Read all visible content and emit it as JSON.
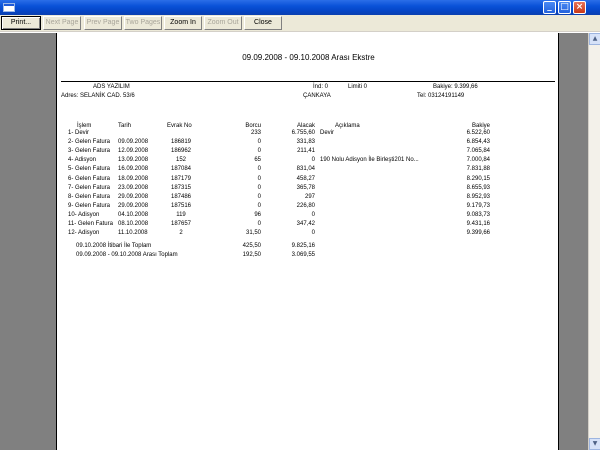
{
  "toolbar": {
    "print": "Print...",
    "next_page": "Next Page",
    "prev_page": "Prev Page",
    "two_pages": "Two Pages",
    "zoom_in": "Zoom In",
    "zoom_out": "Zoom Out",
    "close": "Close"
  },
  "report": {
    "title": "09.09.2008 - 09.10.2008 Arası Ekstre",
    "company": "ADS YAZILIM",
    "address": "Adres: SELANİK CAD. 53/6",
    "discount": "İnd: 0",
    "limit": "Limiti 0",
    "balance": "Bakiye: 9.399,66",
    "district": "ÇANKAYA",
    "phone": "Tel: 03124191149",
    "columns": {
      "islem": "İşlem",
      "tarih": "Tarih",
      "evrak": "Evrak No",
      "borcu": "Borcu",
      "alacak": "Alacak",
      "aciklama": "Açıklama",
      "bakiye": "Bakiye"
    },
    "rows": [
      {
        "islem": "1- Devir",
        "tarih": "",
        "evrak": "",
        "borcu": "233",
        "alacak": "6.755,60",
        "aciklama": "Devir",
        "bakiye": "6.522,60"
      },
      {
        "islem": "2- Gelen Fatura",
        "tarih": "09.09.2008",
        "evrak": "186819",
        "borcu": "0",
        "alacak": "331,83",
        "aciklama": "",
        "bakiye": "6.854,43"
      },
      {
        "islem": "3- Gelen Fatura",
        "tarih": "12.09.2008",
        "evrak": "186962",
        "borcu": "0",
        "alacak": "211,41",
        "aciklama": "",
        "bakiye": "7.065,84"
      },
      {
        "islem": "4- Adisyon",
        "tarih": "13.09.2008",
        "evrak": "152",
        "borcu": "65",
        "alacak": "0",
        "aciklama": "190 Nolu Adisyon İle Birleşti201 No...",
        "bakiye": "7.000,84"
      },
      {
        "islem": "5- Gelen Fatura",
        "tarih": "16.09.2008",
        "evrak": "187084",
        "borcu": "0",
        "alacak": "831,04",
        "aciklama": "",
        "bakiye": "7.831,88"
      },
      {
        "islem": "6- Gelen Fatura",
        "tarih": "18.09.2008",
        "evrak": "187179",
        "borcu": "0",
        "alacak": "458,27",
        "aciklama": "",
        "bakiye": "8.290,15"
      },
      {
        "islem": "7- Gelen Fatura",
        "tarih": "23.09.2008",
        "evrak": "187315",
        "borcu": "0",
        "alacak": "365,78",
        "aciklama": "",
        "bakiye": "8.655,93"
      },
      {
        "islem": "8- Gelen Fatura",
        "tarih": "29.09.2008",
        "evrak": "187486",
        "borcu": "0",
        "alacak": "297",
        "aciklama": "",
        "bakiye": "8.952,93"
      },
      {
        "islem": "9- Gelen Fatura",
        "tarih": "29.09.2008",
        "evrak": "187516",
        "borcu": "0",
        "alacak": "226,80",
        "aciklama": "",
        "bakiye": "9.179,73"
      },
      {
        "islem": "10- Adisyon",
        "tarih": "04.10.2008",
        "evrak": "119",
        "borcu": "96",
        "alacak": "0",
        "aciklama": "",
        "bakiye": "9.083,73"
      },
      {
        "islem": "11- Gelen Fatura",
        "tarih": "08.10.2008",
        "evrak": "187657",
        "borcu": "0",
        "alacak": "347,42",
        "aciklama": "",
        "bakiye": "9.431,16"
      },
      {
        "islem": "12- Adisyon",
        "tarih": "11.10.2008",
        "evrak": "2",
        "borcu": "31,50",
        "alacak": "0",
        "aciklama": "",
        "bakiye": "9.399,66"
      }
    ],
    "totals": [
      {
        "label": "09.10.2008 İtibari İle Toplam",
        "borcu": "425,50",
        "alacak": "9.825,16"
      },
      {
        "label": "09.09.2008 - 09.10.2008 Arası Toplam",
        "borcu": "192,50",
        "alacak": "3.069,55"
      }
    ]
  }
}
